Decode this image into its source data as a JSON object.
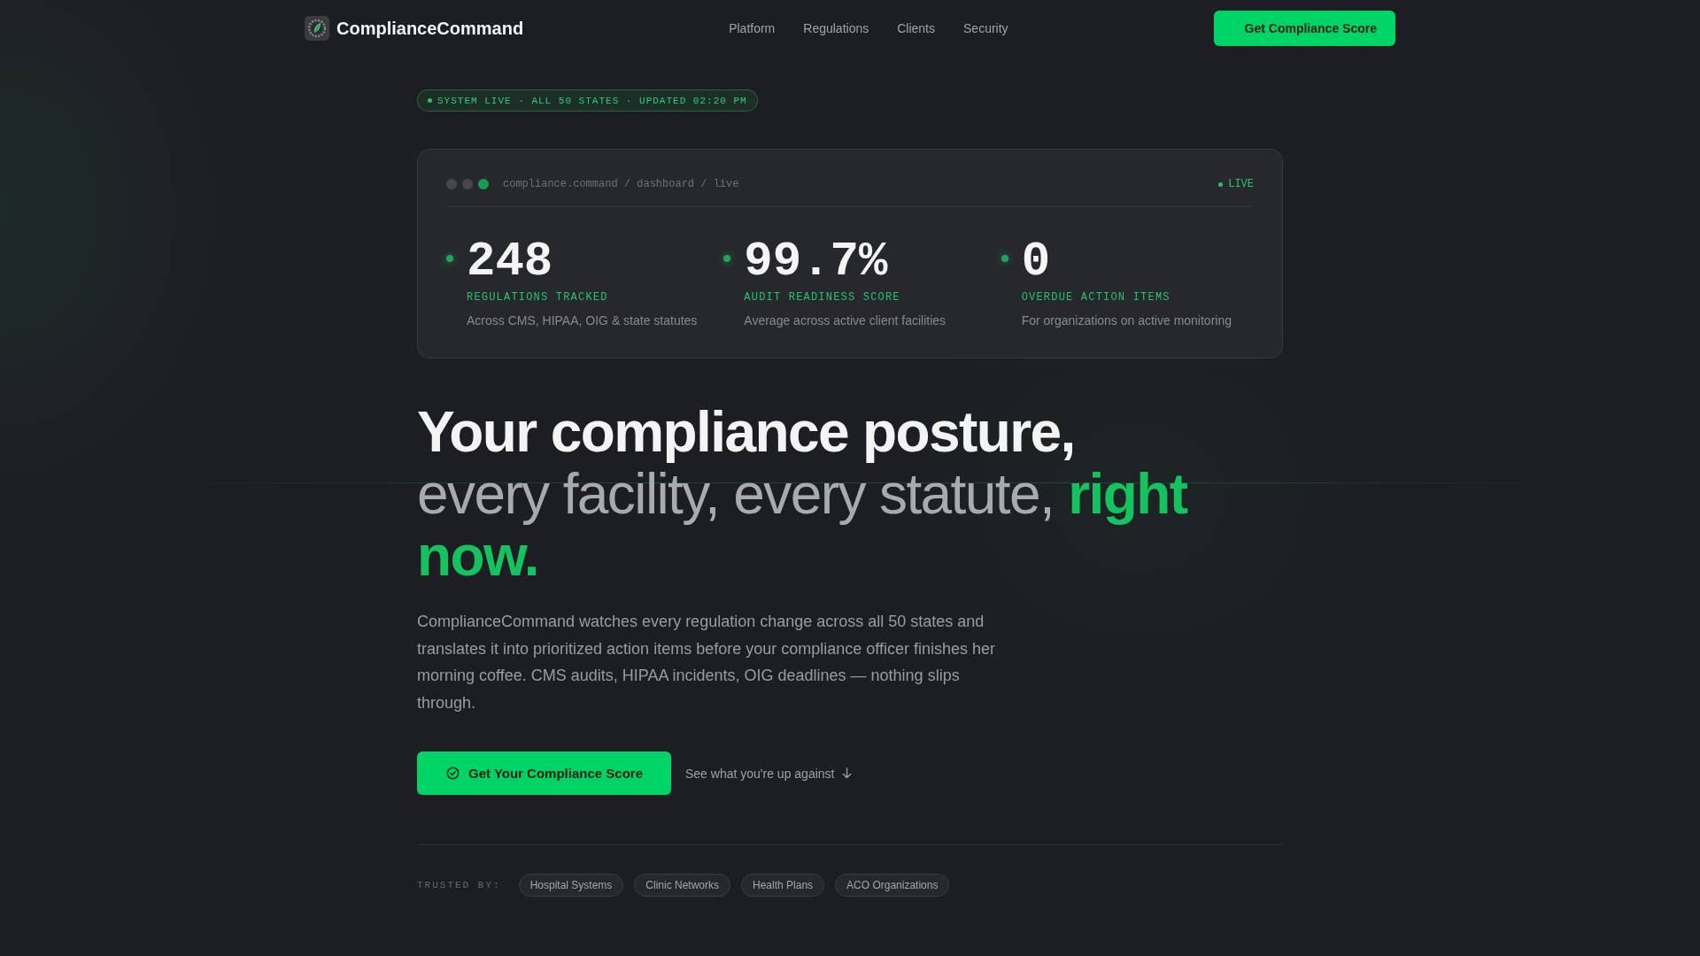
{
  "nav": {
    "brand": "ComplianceCommand",
    "links": [
      {
        "label": "Platform"
      },
      {
        "label": "Regulations"
      },
      {
        "label": "Clients"
      },
      {
        "label": "Security"
      }
    ],
    "cta": "Get Compliance Score"
  },
  "status_pill": "SYSTEM LIVE · ALL 50 STATES · UPDATED 02:20 PM",
  "dashboard": {
    "path": "compliance.command / dashboard / live",
    "live_label": "LIVE",
    "stats": [
      {
        "value": "248",
        "label": "REGULATIONS TRACKED",
        "description": "Across CMS, HIPAA, OIG & state statutes"
      },
      {
        "value": "99.7%",
        "label": "AUDIT READINESS SCORE",
        "description": "Average across active client facilities"
      },
      {
        "value": "0",
        "label": "OVERDUE ACTION ITEMS",
        "description": "For organizations on active monitoring"
      }
    ]
  },
  "headline": {
    "lead": "Your compliance posture,",
    "body": "every facility, every statute,",
    "highlight": "right now."
  },
  "intro": "ComplianceCommand watches every regulation change across all 50 states and translates it into prioritized action items before your compliance officer finishes her morning coffee. CMS audits, HIPAA incidents, OIG deadlines — nothing slips through.",
  "actions": {
    "primary": "Get Your Compliance Score",
    "secondary": "See what you're up against"
  },
  "trusted": {
    "label": "TRUSTED BY:",
    "segments": [
      "Hospital Systems",
      "Clinic Networks",
      "Health Plans",
      "ACO Organizations"
    ]
  }
}
